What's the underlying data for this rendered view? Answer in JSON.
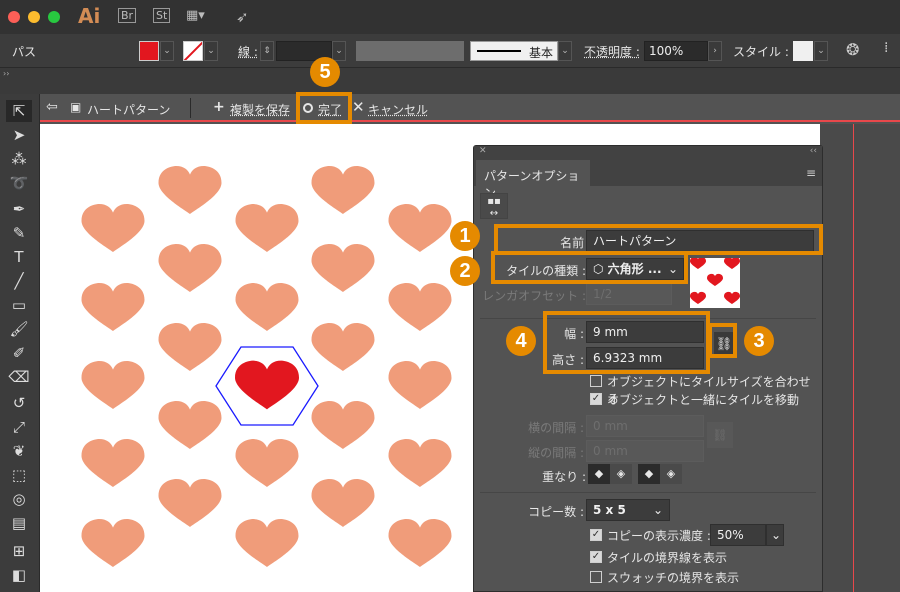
{
  "app": {
    "logo": "Ai",
    "apps": [
      "Br",
      "St"
    ]
  },
  "control_bar": {
    "selection_label": "パス",
    "fill_color": "#e2171f",
    "stroke_label": "線 :",
    "stroke_profile": "基本",
    "opacity_label": "不透明度 :",
    "opacity_value": "100%",
    "style_label": "スタイル :"
  },
  "isolation_bar": {
    "pattern_name": "ハートパターン",
    "save_copy": "複製を保存",
    "done": "完了",
    "cancel": "キャンセル"
  },
  "panel": {
    "title": "パターンオプション",
    "name_label": "名前 :",
    "name_value": "ハートパターン",
    "tile_type_label": "タイルの種類 :",
    "tile_type_value": "六角形 ...",
    "brick_offset_label": "レンガオフセット :",
    "brick_offset_value": "1/2",
    "width_label": "幅 :",
    "width_value": "9 mm",
    "height_label": "高さ :",
    "height_value": "6.9323 mm",
    "fit_tile_label": "オブジェクトにタイルサイズを合わせる",
    "fit_tile_checked": false,
    "move_tile_label": "オブジェクトと一緒にタイルを移動",
    "move_tile_checked": true,
    "h_spacing_label": "横の間隔 :",
    "h_spacing_value": "0 mm",
    "v_spacing_label": "縦の間隔 :",
    "v_spacing_value": "0 mm",
    "overlap_label": "重なり :",
    "copies_label": "コピー数 :",
    "copies_value": "5 x 5",
    "dim_copies_label": "コピーの表示濃度 :",
    "dim_copies_value": "50%",
    "dim_copies_checked": true,
    "show_tile_edge_label": "タイルの境界線を表示",
    "show_tile_edge_checked": true,
    "show_swatch_bounds_label": "スウォッチの境界を表示",
    "show_swatch_bounds_checked": false
  },
  "callouts": [
    "1",
    "2",
    "3",
    "4",
    "5"
  ],
  "colors": {
    "heart_copy": "#f09c7a",
    "heart_main": "#e2171f",
    "tile_bound": "#1a1aff",
    "callout": "#e58a00"
  }
}
